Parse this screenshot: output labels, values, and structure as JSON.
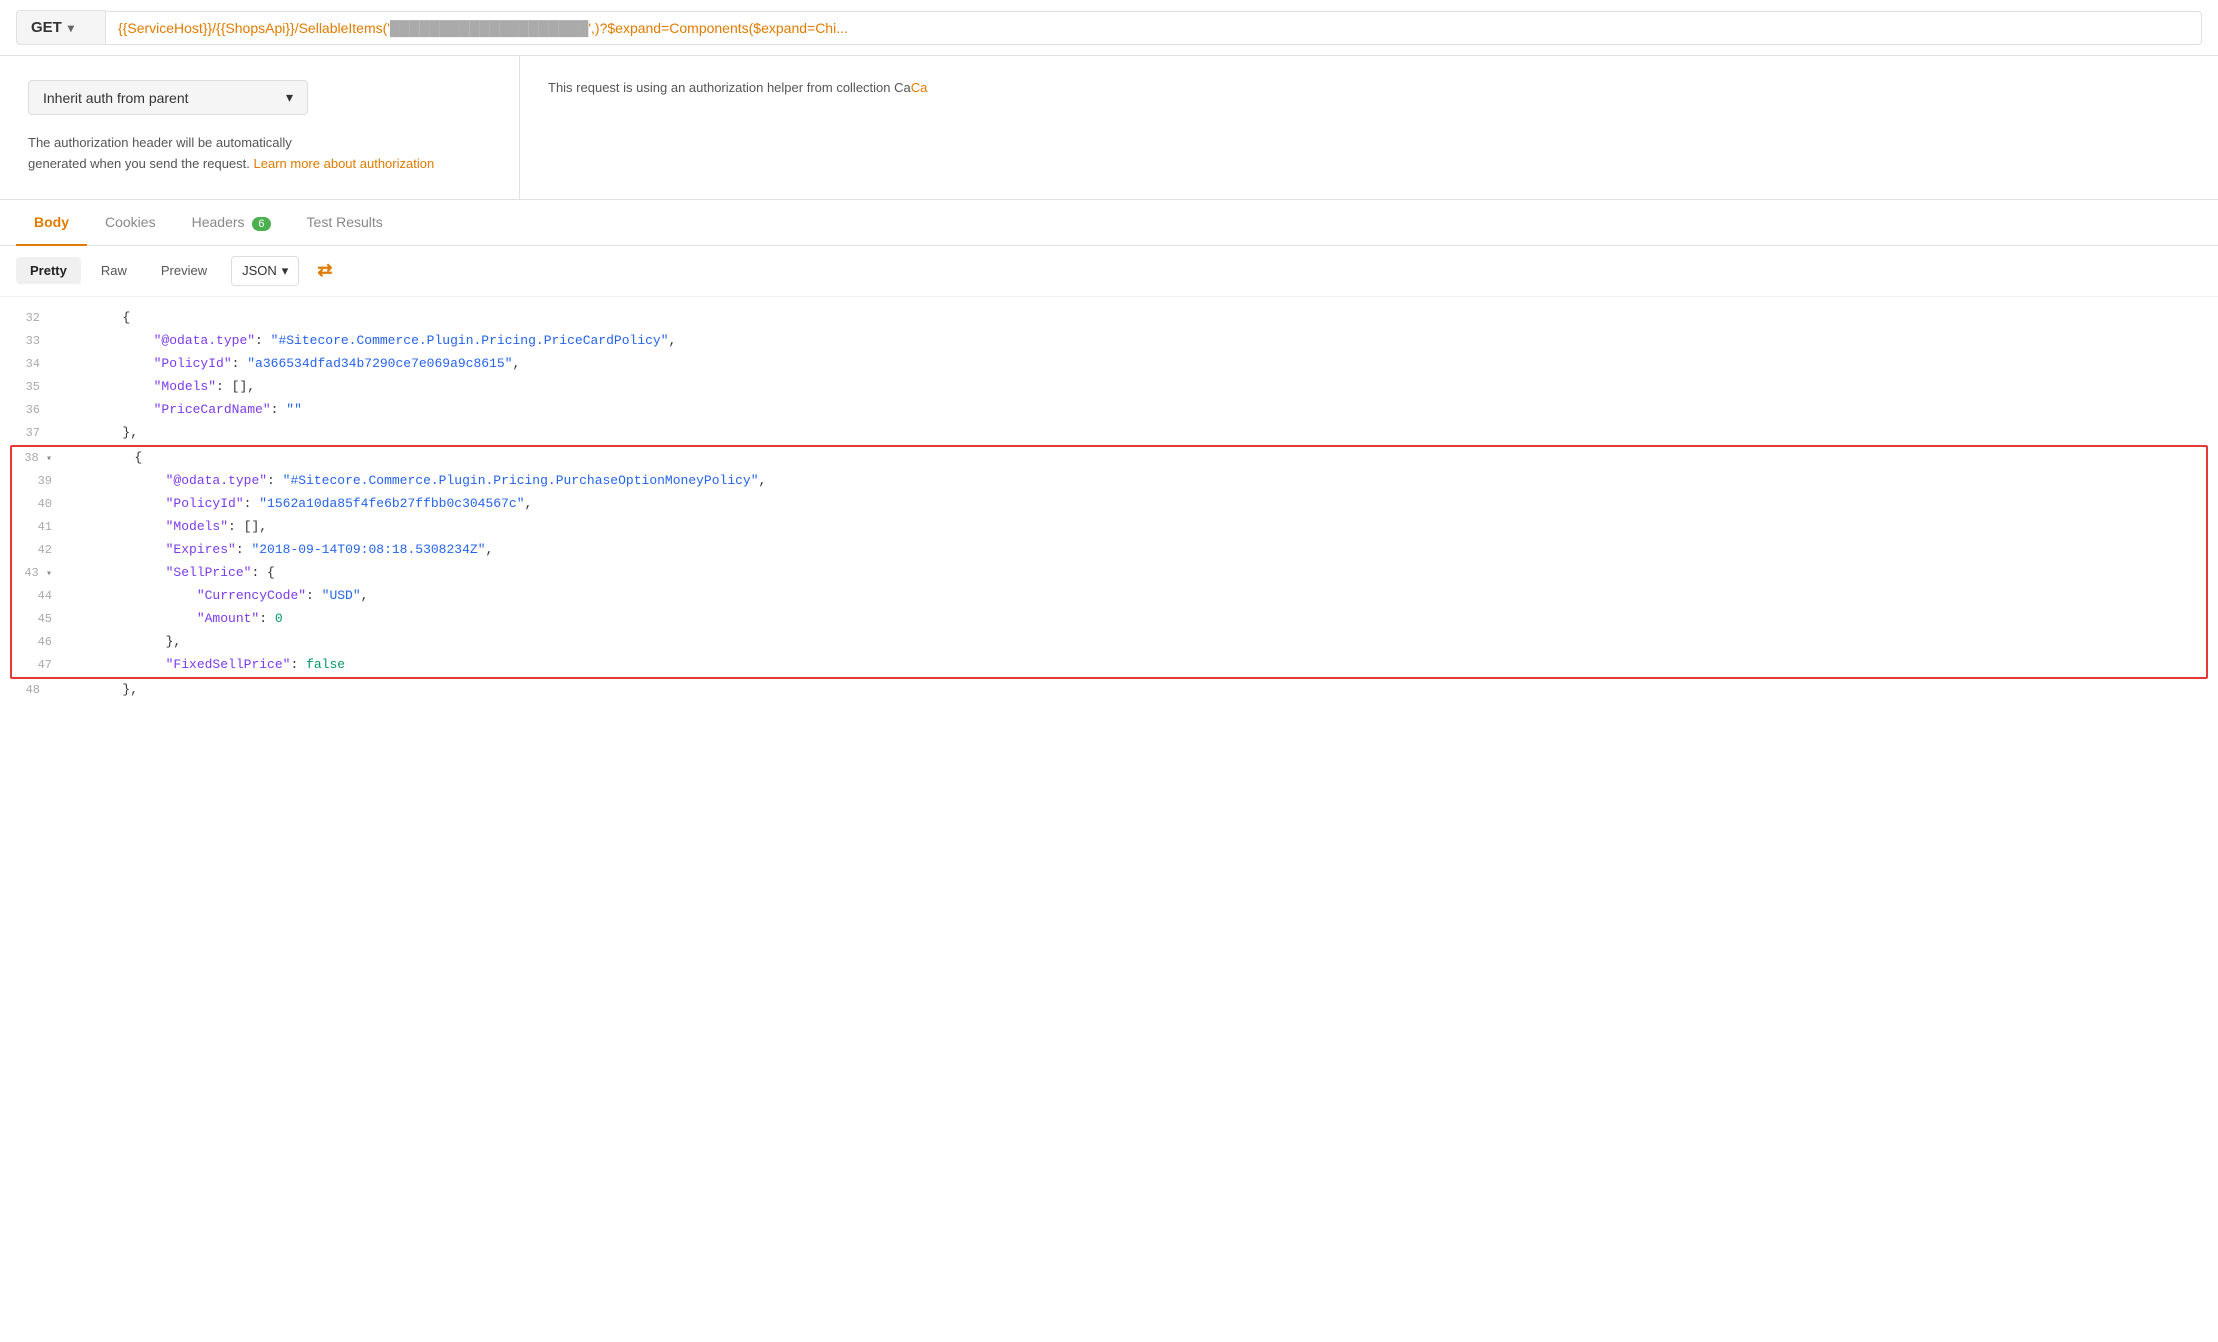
{
  "method": "GET",
  "url": "{{ServiceHost}}/{{ShopsApi}}/SellableItems('",
  "url_suffix": "',)?$expand=Components($expand=Chi...",
  "auth": {
    "dropdown_label": "Inherit auth from parent",
    "description_line1": "The authorization header will be automatically",
    "description_line2": "generated when you send the request.",
    "link_text": "Learn more about authorization",
    "helper_text": "This request is using an authorization helper from collection Ca"
  },
  "tabs": [
    {
      "label": "Body",
      "active": true
    },
    {
      "label": "Cookies",
      "active": false
    },
    {
      "label": "Headers",
      "active": false,
      "badge": "6"
    },
    {
      "label": "Test Results",
      "active": false
    }
  ],
  "format_buttons": [
    {
      "label": "Pretty",
      "active": true
    },
    {
      "label": "Raw",
      "active": false
    },
    {
      "label": "Preview",
      "active": false
    }
  ],
  "format_dropdown": "JSON",
  "code_lines": [
    {
      "num": "32",
      "content": "        {",
      "type": "plain"
    },
    {
      "num": "33",
      "content": "            \"@odata.type\": \"#Sitecore.Commerce.Plugin.Pricing.PriceCardPolicy\",",
      "type": "kv",
      "key": "@odata.type",
      "value": "#Sitecore.Commerce.Plugin.Pricing.PriceCardPolicy",
      "value_type": "str"
    },
    {
      "num": "34",
      "content": "            \"PolicyId\": \"a366534dfad34b7290ce7e069a9c8615\",",
      "type": "kv",
      "key": "PolicyId",
      "value": "a366534dfad34b7290ce7e069a9c8615",
      "value_type": "str"
    },
    {
      "num": "35",
      "content": "            \"Models\": [],",
      "type": "kv",
      "key": "Models",
      "value": "[]",
      "value_type": "arr"
    },
    {
      "num": "36",
      "content": "            \"PriceCardName\": \"\"",
      "type": "kv",
      "key": "PriceCardName",
      "value": "\"\"",
      "value_type": "empty_str"
    },
    {
      "num": "37",
      "content": "        },",
      "type": "plain"
    },
    {
      "num": "38",
      "content": "        {",
      "type": "plain",
      "highlighted": true,
      "collapsible": true
    },
    {
      "num": "39",
      "content": "            \"@odata.type\": \"#Sitecore.Commerce.Plugin.Pricing.PurchaseOptionMoneyPolicy\",",
      "type": "kv",
      "key": "@odata.type",
      "value": "#Sitecore.Commerce.Plugin.Pricing.PurchaseOptionMoneyPolicy",
      "value_type": "str",
      "highlighted": true
    },
    {
      "num": "40",
      "content": "            \"PolicyId\": \"1562a10da85f4fe6b27ffbb0c304567c\",",
      "type": "kv",
      "key": "PolicyId",
      "value": "1562a10da85f4fe6b27ffbb0c304567c",
      "value_type": "str",
      "highlighted": true
    },
    {
      "num": "41",
      "content": "            \"Models\": [],",
      "type": "kv",
      "key": "Models",
      "value": "[]",
      "value_type": "arr",
      "highlighted": true
    },
    {
      "num": "42",
      "content": "            \"Expires\": \"2018-09-14T09:08:18.5308234Z\",",
      "type": "kv",
      "key": "Expires",
      "value": "2018-09-14T09:08:18.5308234Z",
      "value_type": "str",
      "highlighted": true
    },
    {
      "num": "43",
      "content": "            \"SellPrice\": {",
      "type": "kv_obj",
      "key": "SellPrice",
      "highlighted": true,
      "collapsible": true
    },
    {
      "num": "44",
      "content": "                \"CurrencyCode\": \"USD\",",
      "type": "kv",
      "key": "CurrencyCode",
      "value": "USD",
      "value_type": "str",
      "highlighted": true,
      "indent": true
    },
    {
      "num": "45",
      "content": "                \"Amount\": 0",
      "type": "kv",
      "key": "Amount",
      "value": "0",
      "value_type": "num",
      "highlighted": true,
      "indent": true
    },
    {
      "num": "46",
      "content": "            },",
      "type": "plain",
      "highlighted": true
    },
    {
      "num": "47",
      "content": "            \"FixedSellPrice\": false",
      "type": "kv",
      "key": "FixedSellPrice",
      "value": "false",
      "value_type": "bool",
      "highlighted": true
    },
    {
      "num": "48",
      "content": "        },",
      "type": "plain"
    }
  ]
}
